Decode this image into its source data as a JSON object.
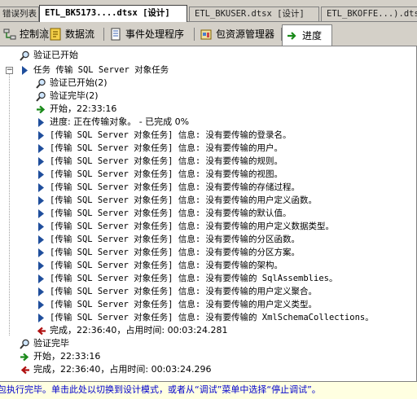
{
  "doc_tabs": [
    {
      "label": "错误列表"
    },
    {
      "label": "ETL_BK5173....dtsx [设计]"
    },
    {
      "label": "ETL_BKUSER.dtsx [设计]"
    },
    {
      "label": "ETL_BKOFFE...).dtsx"
    }
  ],
  "designer_tabs": [
    {
      "label": "控制流",
      "icon": "control-flow-icon"
    },
    {
      "label": "数据流",
      "icon": "data-flow-icon"
    },
    {
      "label": "事件处理程序",
      "icon": "event-handler-icon"
    },
    {
      "label": "包资源管理器",
      "icon": "package-explorer-icon"
    },
    {
      "label": "进度",
      "icon": "progress-icon"
    }
  ],
  "progress": {
    "validation_start": "验证已开始",
    "task_title": "任务 传输 SQL Server 对象任务",
    "task_validation_start": "验证已开始(2)",
    "task_validation_done": "验证完毕(2)",
    "start": "开始，22:33:16",
    "progress_line": "进度: 正在传输对象。 - 已完成 0%",
    "messages": [
      "[传输 SQL Server 对象任务] 信息: 没有要传输的登录名。",
      "[传输 SQL Server 对象任务] 信息: 没有要传输的用户。",
      "[传输 SQL Server 对象任务] 信息: 没有要传输的规则。",
      "[传输 SQL Server 对象任务] 信息: 没有要传输的视图。",
      "[传输 SQL Server 对象任务] 信息: 没有要传输的存储过程。",
      "[传输 SQL Server 对象任务] 信息: 没有要传输的用户定义函数。",
      "[传输 SQL Server 对象任务] 信息: 没有要传输的默认值。",
      "[传输 SQL Server 对象任务] 信息: 没有要传输的用户定义数据类型。",
      "[传输 SQL Server 对象任务] 信息: 没有要传输的分区函数。",
      "[传输 SQL Server 对象任务] 信息: 没有要传输的分区方案。",
      "[传输 SQL Server 对象任务] 信息: 没有要传输的架构。",
      "[传输 SQL Server 对象任务] 信息: 没有要传输的 SqlAssemblies。",
      "[传输 SQL Server 对象任务] 信息: 没有要传输的用户定义聚合。",
      "[传输 SQL Server 对象任务] 信息: 没有要传输的用户定义类型。",
      "[传输 SQL Server 对象任务] 信息: 没有要传输的 XmlSchemaCollections。"
    ],
    "task_finish": "完成，22:36:40，占用时间: 00:03:24.281",
    "validation_done": "验证完毕",
    "pkg_start": "开始，22:33:16",
    "pkg_finish": "完成，22:36:40，占用时间: 00:03:24.296"
  },
  "statusbar": {
    "text": "包执行完毕。单击此处以切换到设计模式，或者从“调试”菜单中选择“停止调试”。"
  },
  "colors": {
    "info_icon": "#1f4e9c",
    "start_arrow": "#1a8a1a",
    "finish_arrow": "#b01010",
    "status_text": "#0000cc"
  }
}
